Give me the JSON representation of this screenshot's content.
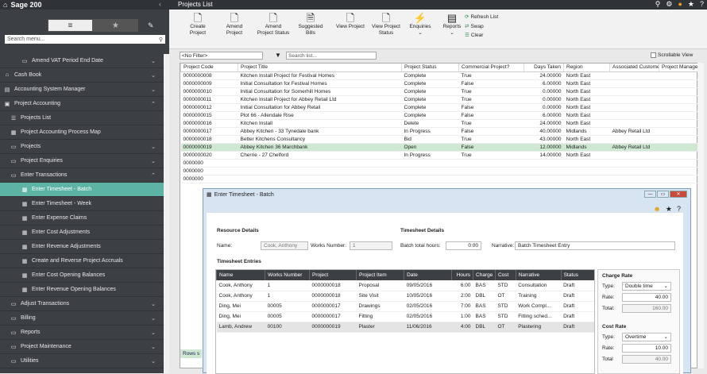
{
  "app": {
    "brand": "Sage 200",
    "collapse_glyph": "‹",
    "page_title": "Projects List"
  },
  "sidebar": {
    "search_placeholder": "Search menu...",
    "items": [
      {
        "label": "Amend VAT Period End Date",
        "icon": "folder-icon",
        "chev": "⌄"
      },
      {
        "label": "Cash Book",
        "icon": "bank-icon",
        "chev": "⌄"
      },
      {
        "label": "Accounting System Manager",
        "icon": "ledger-icon",
        "chev": "⌄"
      },
      {
        "label": "Project Accounting",
        "icon": "clipboard-icon",
        "chev": "⌃"
      },
      {
        "label": "Projects List",
        "icon": "list-icon",
        "chev": ""
      },
      {
        "label": "Project Accounting Process Map",
        "icon": "map-icon",
        "chev": ""
      },
      {
        "label": "Projects",
        "icon": "folder-icon",
        "chev": "⌄"
      },
      {
        "label": "Project Enquiries",
        "icon": "folder-icon",
        "chev": "⌄"
      },
      {
        "label": "Enter Transactions",
        "icon": "folder-icon",
        "chev": "⌃"
      },
      {
        "label": "Enter Timesheet - Batch",
        "icon": "grid-icon",
        "chev": ""
      },
      {
        "label": "Enter Timesheet - Week",
        "icon": "grid-icon",
        "chev": ""
      },
      {
        "label": "Enter Expense Claims",
        "icon": "grid-icon",
        "chev": ""
      },
      {
        "label": "Enter Cost Adjustments",
        "icon": "grid-icon",
        "chev": ""
      },
      {
        "label": "Enter Revenue Adjustments",
        "icon": "grid-icon",
        "chev": ""
      },
      {
        "label": "Create and Reverse Project Accruals",
        "icon": "grid-icon",
        "chev": ""
      },
      {
        "label": "Enter Cost Opening Balances",
        "icon": "grid-icon",
        "chev": ""
      },
      {
        "label": "Enter Revenue Opening Balances",
        "icon": "grid-icon",
        "chev": ""
      },
      {
        "label": "Adjust Transactions",
        "icon": "folder-icon",
        "chev": "⌄"
      },
      {
        "label": "Billing",
        "icon": "folder-icon",
        "chev": "⌄"
      },
      {
        "label": "Reports",
        "icon": "folder-icon",
        "chev": "⌄"
      },
      {
        "label": "Project Maintenance",
        "icon": "folder-icon",
        "chev": "⌄"
      },
      {
        "label": "Utilities",
        "icon": "folder-icon",
        "chev": "⌄"
      }
    ]
  },
  "ribbon": {
    "buttons": [
      "Create Project",
      "Amend Project",
      "Amend Project Status",
      "Suggested Bills",
      "View Project",
      "View Project Status",
      "Enquiries",
      "Reports"
    ],
    "refresh": "Refresh List",
    "swap": "Swap",
    "clear": "Clear"
  },
  "filter": {
    "value": "<No Filter>",
    "search_placeholder": "Search list...",
    "scrollable_view": "Scrollable View"
  },
  "grid": {
    "columns": [
      "Project Code",
      "Project Title",
      "Project Status",
      "Commercial Project?",
      "Days Taken",
      "Region",
      "Associated Customer",
      "Project Manager"
    ],
    "rows": [
      [
        "0000000008",
        "Kitchen Install Project for Festival Homes",
        "Complete",
        "True",
        "24.00000",
        "North East",
        "",
        ""
      ],
      [
        "0000000009",
        "Initial Consultation for Festival Homes",
        "Complete",
        "False",
        "6.00000",
        "North East",
        "",
        ""
      ],
      [
        "0000000010",
        "Initial Consultation for Somerhill Homes",
        "Complete",
        "True",
        "0.00000",
        "North East",
        "",
        ""
      ],
      [
        "0000000011",
        "Kitchen Install Project for Abbey Retail Ltd",
        "Complete",
        "True",
        "0.00000",
        "North East",
        "",
        ""
      ],
      [
        "0000000012",
        "Initial Consultation for Abbey Retail",
        "Complete",
        "False",
        "0.00000",
        "North East",
        "",
        ""
      ],
      [
        "0000000015",
        "Plot 66 - Allendale Rise",
        "Complete",
        "False",
        "6.00000",
        "North East",
        "",
        ""
      ],
      [
        "0000000016",
        "Kitchen Install",
        "Delete",
        "True",
        "24.00000",
        "North East",
        "",
        ""
      ],
      [
        "0000000017",
        "Abbey Kitchen - 33 Tynedale bank",
        "In Progress",
        "False",
        "40.00000",
        "Midlands",
        "Abbey Retail Ltd",
        ""
      ],
      [
        "0000000018",
        "Better Kitchens Consultancy",
        "Bid",
        "True",
        "43.00000",
        "North East",
        "",
        ""
      ],
      [
        "0000000019",
        "Abbey Kitchen 36 Marchbank",
        "Open",
        "False",
        "12.00000",
        "Midlands",
        "Abbey Retail Ltd",
        ""
      ],
      [
        "0000000020",
        "Cherrie - 27 Chelford",
        "In Progress",
        "True",
        "14.00000",
        "North East",
        "",
        ""
      ],
      [
        "0000000",
        "",
        "",
        "",
        "",
        "",
        "",
        ""
      ],
      [
        "0000000",
        "",
        "",
        "",
        "",
        "",
        "",
        ""
      ],
      [
        "0000000",
        "",
        "",
        "",
        "",
        "",
        "",
        ""
      ]
    ],
    "rows_label": "Rows s"
  },
  "dialog": {
    "title": "Enter Timesheet - Batch",
    "resource_header": "Resource Details",
    "name_label": "Name:",
    "name_value": "Cook, Anthony",
    "works_label": "Works Number:",
    "works_value": "1",
    "ts_header": "Timesheet Details",
    "batch_label": "Batch total hours:",
    "batch_value": "0:00",
    "narr_label": "Narrative:",
    "narr_value": "Batch Timesheet Entry",
    "entries_header": "Timesheet Entries",
    "columns": [
      "Name",
      "Works Number",
      "Project",
      "Project Item",
      "Date",
      "Hours",
      "Charge",
      "Cost",
      "Narrative",
      "Status"
    ],
    "rows": [
      [
        "Cook, Anthony",
        "1",
        "0000000018",
        "Proposal",
        "09/05/2016",
        "6:00",
        "BAS",
        "STD",
        "Consultation",
        "Draft"
      ],
      [
        "Cook, Anthony",
        "1",
        "0000000018",
        "Site Visit",
        "10/05/2016",
        "2:00",
        "DBL",
        "OT",
        "Training",
        "Draft"
      ],
      [
        "Ding, Mei",
        "00005",
        "0000000017",
        "Drawings",
        "02/05/2016",
        "7:00",
        "BAS",
        "STD",
        "Work Compl...",
        "Draft"
      ],
      [
        "Ding, Mei",
        "00005",
        "0000000017",
        "Fitting",
        "02/05/2016",
        "1:00",
        "BAS",
        "STD",
        "Fitting sched...",
        "Draft"
      ],
      [
        "Lamb, Andrew",
        "00100",
        "0000000019",
        "Plaster",
        "11/06/2016",
        "4:00",
        "DBL",
        "OT",
        "Plastering",
        "Draft"
      ]
    ],
    "charge": {
      "header": "Charge Rate",
      "type_label": "Type:",
      "type_value": "Double time",
      "rate_label": "Rate:",
      "rate_value": "40.00",
      "total_label": "Total:",
      "total_value": "160.00"
    },
    "cost": {
      "header": "Cost Rate",
      "type_label": "Type:",
      "type_value": "Overtime",
      "rate_label": "Rate:",
      "rate_value": "10.00",
      "total_label": "Total",
      "total_value": "40.00"
    }
  }
}
